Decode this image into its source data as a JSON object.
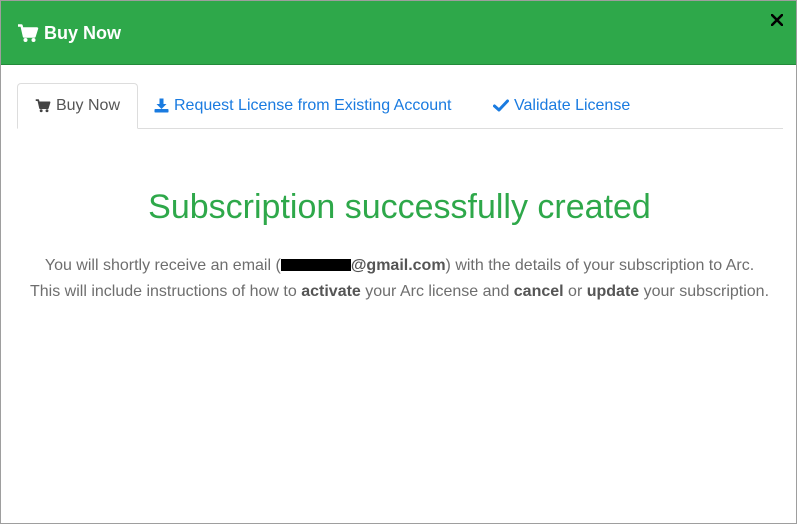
{
  "dialog": {
    "title": "Buy Now",
    "close_label": "×"
  },
  "tabs": [
    {
      "label": "Buy Now",
      "icon": "cart-icon",
      "active": true
    },
    {
      "label": "Request License from Existing Account",
      "icon": "download-icon",
      "active": false
    },
    {
      "label": "Validate License",
      "icon": "check-icon",
      "active": false
    }
  ],
  "content": {
    "heading": "Subscription successfully created",
    "line1_before": "You will shortly receive an email (",
    "line1_email_visible": "@gmail.com",
    "line1_after": ") with the details of your subscription to Arc.",
    "line2_part1": "This will include instructions of how to ",
    "line2_bold1": "activate",
    "line2_part2": " your Arc license and ",
    "line2_bold2": "cancel",
    "line2_part3": " or ",
    "line2_bold3": "update",
    "line2_part4": " your subscription."
  },
  "colors": {
    "header_green": "#2ea84a",
    "heading_green": "#2ea84a",
    "link_blue": "#1a7be0",
    "body_text": "#6e6e6e"
  }
}
